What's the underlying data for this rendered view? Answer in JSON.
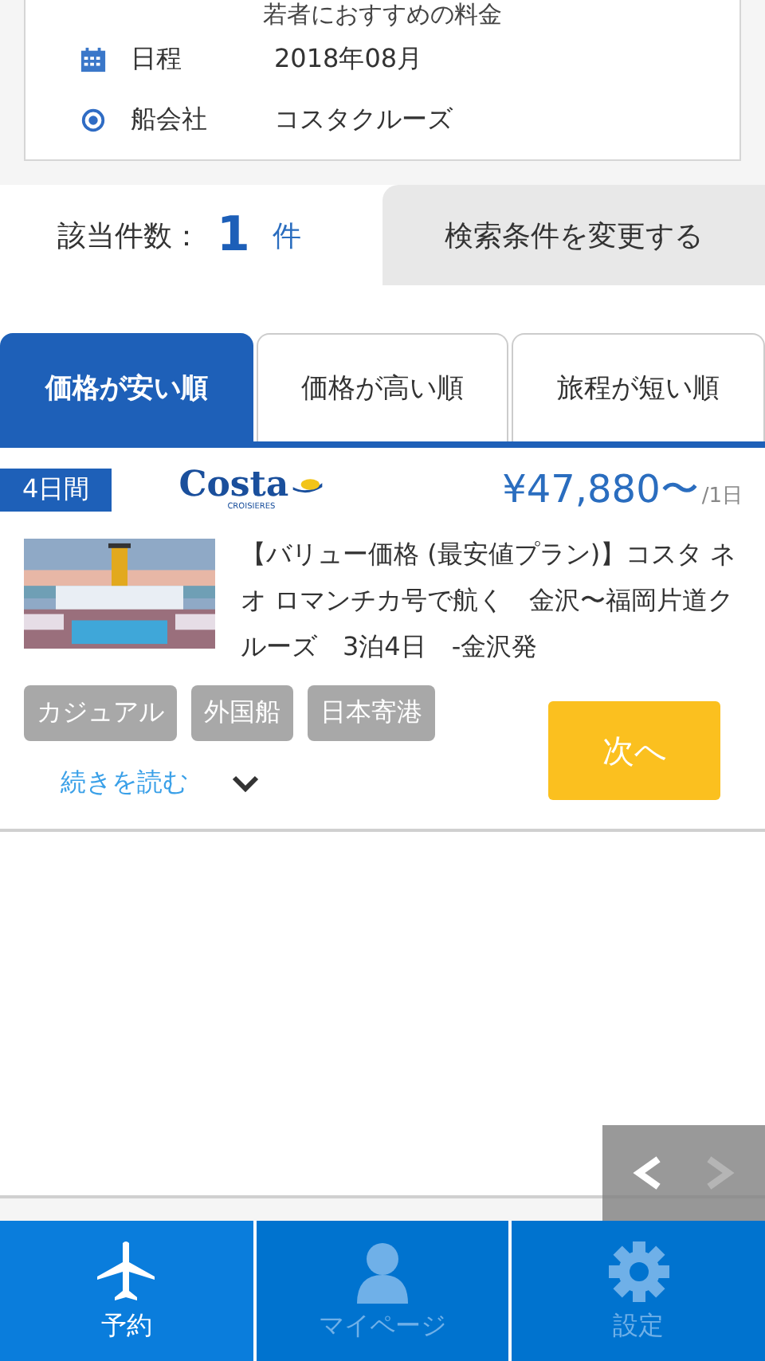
{
  "conditions": {
    "note": "若者におすすめの料金",
    "rows": [
      {
        "kind": "calendar",
        "label": "日程",
        "value": "2018年08月"
      },
      {
        "kind": "radio",
        "label": "船会社",
        "value": "コスタクルーズ"
      }
    ]
  },
  "result": {
    "label": "該当件数：",
    "count": "1",
    "unit": "件",
    "change_button": "検索条件を変更する"
  },
  "sort_tabs": [
    {
      "label": "価格が安い順",
      "selected": true
    },
    {
      "label": "価格が高い順",
      "selected": false
    },
    {
      "label": "旅程が短い順",
      "selected": false
    }
  ],
  "cruises": [
    {
      "duration": "4日間",
      "logo": "Costa",
      "logo_sub": "CROISIERES",
      "price": "¥47,880〜",
      "price_unit": "/1日",
      "title": "【バリュー価格 (最安値プラン)】コスタ ネオ ロマンチカ号で航く　金沢〜福岡片道クルーズ　3泊4日　-金沢発",
      "tags": [
        "カジュアル",
        "外国船",
        "日本寄港"
      ],
      "read_more": "続きを読む",
      "next_button": "次へ"
    }
  ],
  "pager": {
    "prev_disabled": false,
    "next_disabled": true
  },
  "nav": [
    {
      "kind": "plane",
      "label": "予約",
      "selected": true
    },
    {
      "kind": "person",
      "label": "マイページ",
      "selected": false
    },
    {
      "kind": "gear",
      "label": "設定",
      "selected": false
    }
  ]
}
